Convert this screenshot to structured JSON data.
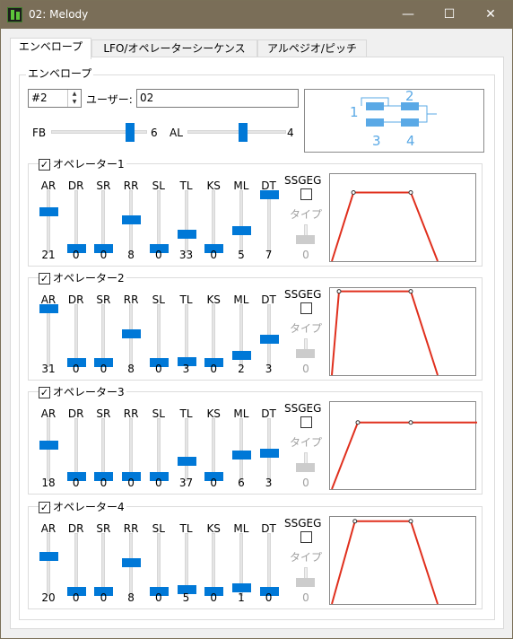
{
  "window": {
    "title": "02: Melody",
    "minimize_glyph": "—",
    "maximize_glyph": "☐",
    "close_glyph": "✕"
  },
  "tabs": [
    {
      "label": "エンベロープ",
      "active": true
    },
    {
      "label": "LFO/オペレーターシーケンス",
      "active": false
    },
    {
      "label": "アルペジオ/ピッチ",
      "active": false
    }
  ],
  "envelope": {
    "group_label": "エンベロープ",
    "preset": {
      "value": "#2",
      "up": "▲",
      "down": "▼"
    },
    "user_label": "ユーザー:",
    "user_value": "02",
    "fb": {
      "label": "FB",
      "value": "6",
      "max": 7
    },
    "al": {
      "label": "AL",
      "value": "4",
      "max": 7
    },
    "algorithm_labels": [
      "1",
      "2",
      "3",
      "4"
    ]
  },
  "columns": [
    "AR",
    "DR",
    "SR",
    "RR",
    "SL",
    "TL",
    "KS",
    "ML",
    "DT"
  ],
  "column_max": [
    31,
    31,
    31,
    15,
    15,
    127,
    3,
    15,
    7
  ],
  "ssgeg_label": "SSGEG",
  "type_label": "タイプ",
  "operators": [
    {
      "label": "オペレーター1",
      "checked": true,
      "check_glyph": "✓",
      "values": [
        "21",
        "0",
        "0",
        "8",
        "0",
        "33",
        "0",
        "5",
        "7"
      ],
      "ssg_value": "0"
    },
    {
      "label": "オペレーター2",
      "checked": true,
      "check_glyph": "✓",
      "values": [
        "31",
        "0",
        "0",
        "8",
        "0",
        "3",
        "0",
        "2",
        "3"
      ],
      "ssg_value": "0"
    },
    {
      "label": "オペレーター3",
      "checked": true,
      "check_glyph": "✓",
      "values": [
        "18",
        "0",
        "0",
        "0",
        "0",
        "37",
        "0",
        "6",
        "3"
      ],
      "ssg_value": "0"
    },
    {
      "label": "オペレーター4",
      "checked": true,
      "check_glyph": "✓",
      "values": [
        "20",
        "0",
        "0",
        "8",
        "0",
        "5",
        "0",
        "1",
        "0"
      ],
      "ssg_value": "0"
    }
  ],
  "colors": {
    "accent": "#0078d7",
    "titlebar": "#7a6e58",
    "envelope_line": "#e0301e",
    "algorithm": "#5aa9e6"
  }
}
